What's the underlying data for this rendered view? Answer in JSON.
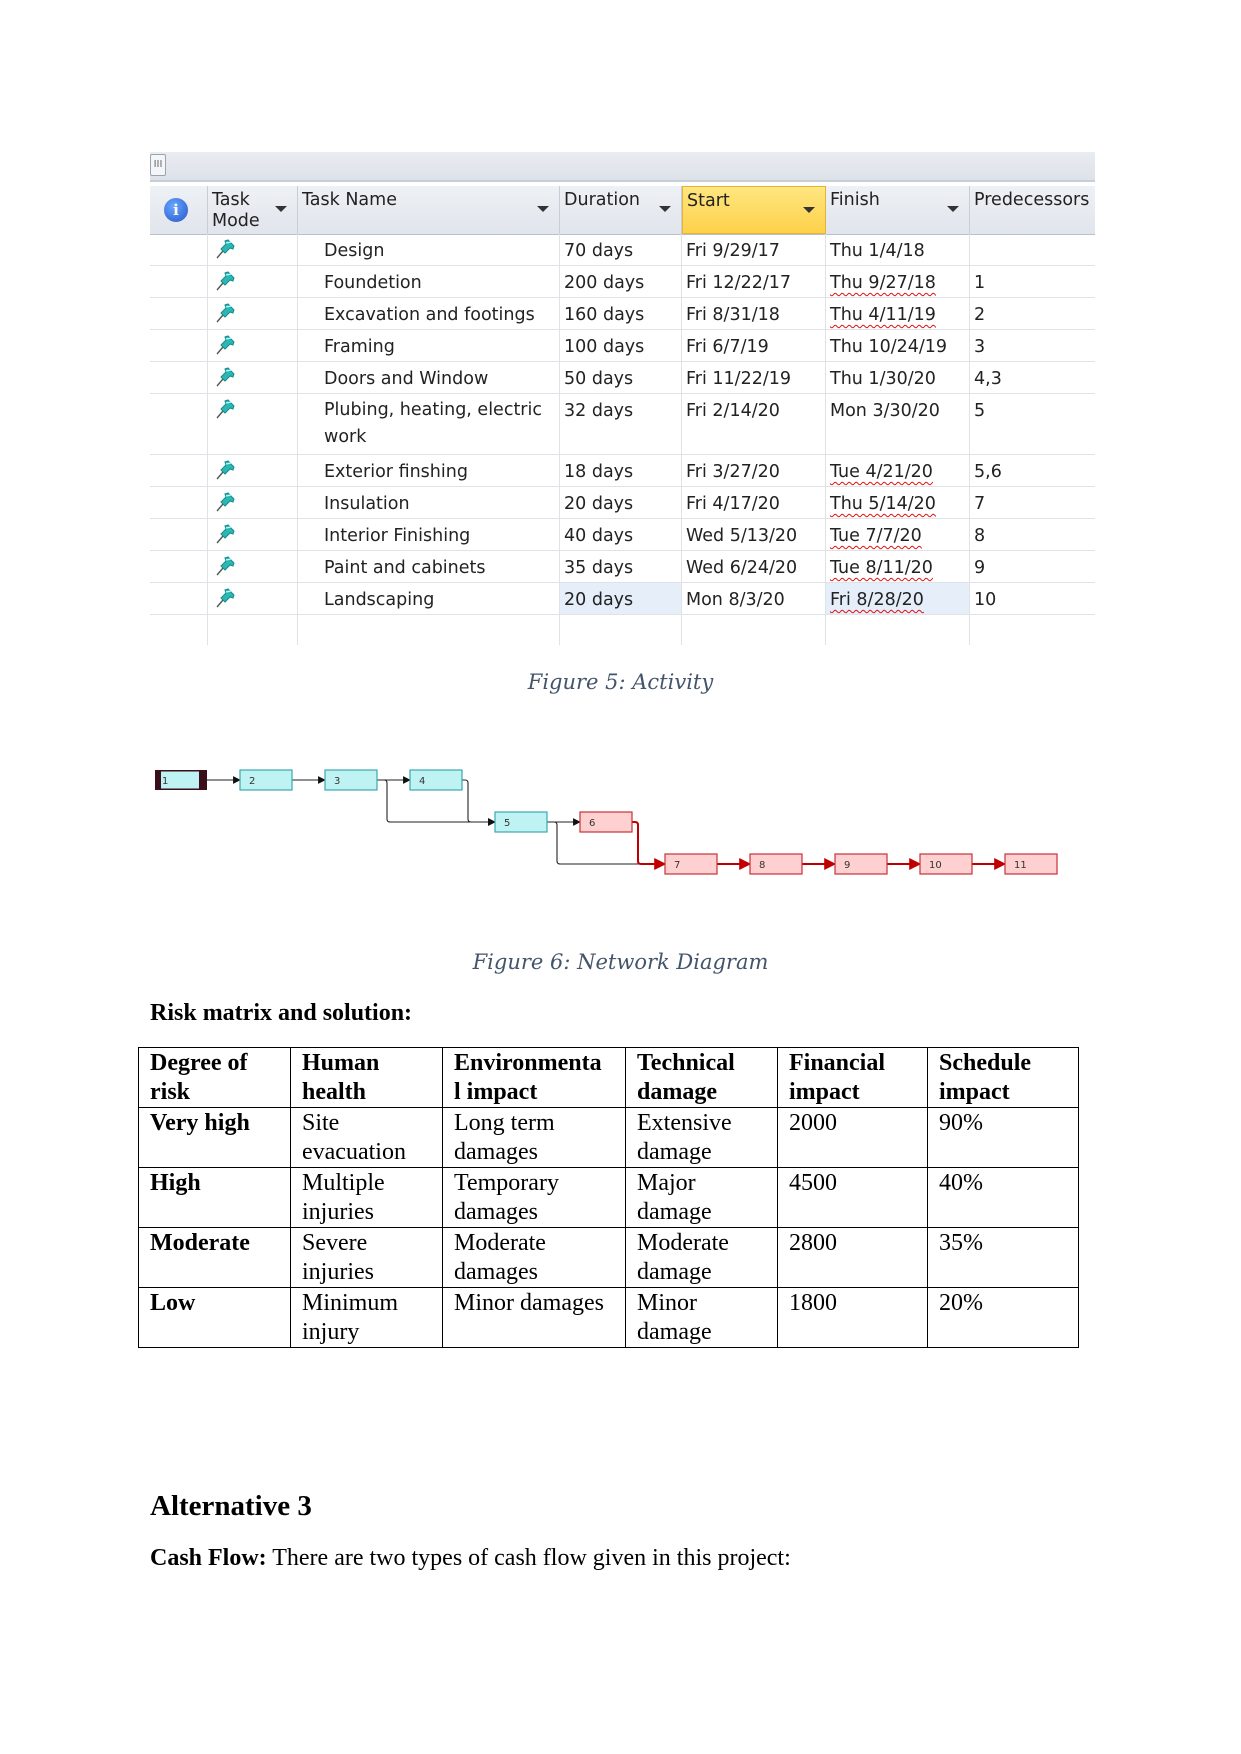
{
  "project_screenshot": {
    "columns": [
      {
        "key": "info",
        "label": ""
      },
      {
        "key": "mode",
        "label": "Task Mode"
      },
      {
        "key": "name",
        "label": "Task Name"
      },
      {
        "key": "duration",
        "label": "Duration"
      },
      {
        "key": "start",
        "label": "Start"
      },
      {
        "key": "finish",
        "label": "Finish"
      },
      {
        "key": "pred",
        "label": "Predecessors"
      }
    ],
    "info_icon_glyph": "i",
    "scroll_thumb_glyph": "III",
    "tasks": [
      {
        "name": "Design",
        "duration": "70 days",
        "start": "Fri 9/29/17",
        "finish": "Thu 1/4/18",
        "predecessors": "",
        "finish_flagged": false
      },
      {
        "name": "Foundetion",
        "duration": "200 days",
        "start": "Fri 12/22/17",
        "finish": "Thu 9/27/18",
        "predecessors": "1",
        "finish_flagged": true
      },
      {
        "name": "Excavation and footings",
        "duration": "160 days",
        "start": "Fri 8/31/18",
        "finish": "Thu 4/11/19",
        "predecessors": "2",
        "finish_flagged": true
      },
      {
        "name": "Framing",
        "duration": "100 days",
        "start": "Fri 6/7/19",
        "finish": "Thu 10/24/19",
        "predecessors": "3",
        "finish_flagged": false
      },
      {
        "name": "Doors and Window",
        "duration": "50 days",
        "start": "Fri 11/22/19",
        "finish": "Thu 1/30/20",
        "predecessors": "4,3",
        "finish_flagged": false
      },
      {
        "name": "Plubing, heating, electric work",
        "duration": "32 days",
        "start": "Fri 2/14/20",
        "finish": "Mon 3/30/20",
        "predecessors": "5",
        "finish_flagged": false
      },
      {
        "name": "Exterior finshing",
        "duration": "18 days",
        "start": "Fri 3/27/20",
        "finish": "Tue 4/21/20",
        "predecessors": "5,6",
        "finish_flagged": true
      },
      {
        "name": "Insulation",
        "duration": "20 days",
        "start": "Fri 4/17/20",
        "finish": "Thu 5/14/20",
        "predecessors": "7",
        "finish_flagged": true
      },
      {
        "name": "Interior Finishing",
        "duration": "40 days",
        "start": "Wed 5/13/20",
        "finish": "Tue 7/7/20",
        "predecessors": "8",
        "finish_flagged": true
      },
      {
        "name": "Paint and cabinets",
        "duration": "35 days",
        "start": "Wed 6/24/20",
        "finish": "Tue 8/11/20",
        "predecessors": "9",
        "finish_flagged": true
      },
      {
        "name": "Landscaping",
        "duration": "20 days",
        "start": "Mon 8/3/20",
        "finish": "Fri 8/28/20",
        "predecessors": "10",
        "finish_flagged": true
      }
    ],
    "highlight_color": "#fdd14a",
    "pin_color": "#2bb7b3"
  },
  "figure5_caption": "Figure 5: Activity",
  "network": {
    "nodes": [
      {
        "id": "1",
        "critical": false,
        "start": true
      },
      {
        "id": "2",
        "critical": false
      },
      {
        "id": "3",
        "critical": false
      },
      {
        "id": "4",
        "critical": false
      },
      {
        "id": "5",
        "critical": false
      },
      {
        "id": "6",
        "critical": true
      },
      {
        "id": "7",
        "critical": true
      },
      {
        "id": "8",
        "critical": true
      },
      {
        "id": "9",
        "critical": true
      },
      {
        "id": "10",
        "critical": true
      },
      {
        "id": "11",
        "critical": true
      }
    ],
    "edges": [
      {
        "from": "1",
        "to": "2",
        "critical": false
      },
      {
        "from": "2",
        "to": "3",
        "critical": false
      },
      {
        "from": "3",
        "to": "4",
        "critical": false
      },
      {
        "from": "3",
        "to": "5",
        "critical": false
      },
      {
        "from": "4",
        "to": "5",
        "critical": false
      },
      {
        "from": "5",
        "to": "6",
        "critical": false
      },
      {
        "from": "5",
        "to": "7",
        "critical": false
      },
      {
        "from": "6",
        "to": "7",
        "critical": true
      },
      {
        "from": "7",
        "to": "8",
        "critical": true
      },
      {
        "from": "8",
        "to": "9",
        "critical": true
      },
      {
        "from": "9",
        "to": "10",
        "critical": true
      },
      {
        "from": "10",
        "to": "11",
        "critical": true
      }
    ],
    "colors": {
      "normal_fill": "#bff3f3",
      "normal_stroke": "#3aa9b0",
      "critical_fill": "#ffd0d0",
      "critical_stroke": "#c8303a",
      "critical_line": "#c00000",
      "start_frame": "#3a0f1a"
    }
  },
  "figure6_caption": "Figure 6: Network Diagram",
  "risk_heading": "Risk matrix and solution:",
  "risk_table": {
    "headers": [
      "Degree of risk",
      "Human health",
      "Environmental impact",
      "Technical damage",
      "Financial impact",
      "Schedule impact"
    ],
    "header_display": [
      "Degree of\nrisk",
      "Human\nhealth",
      "Environmenta\nl impact",
      "Technical\ndamage",
      "Financial\nimpact",
      "Schedule\nimpact"
    ],
    "rows": [
      {
        "level": "Very high",
        "human": "Site evacuation",
        "env": "Long term damages",
        "tech": "Extensive damage",
        "fin": "2000",
        "sched": "90%"
      },
      {
        "level": "High",
        "human": "Multiple injuries",
        "env": "Temporary damages",
        "tech": "Major damage",
        "fin": "4500",
        "sched": "40%"
      },
      {
        "level": "Moderate",
        "human": "Severe injuries",
        "env": "Moderate damages",
        "tech": "Moderate damage",
        "fin": "2800",
        "sched": "35%"
      },
      {
        "level": "Low",
        "human": "Minimum injury",
        "env": "Minor damages",
        "tech": "Minor damage",
        "fin": "1800",
        "sched": "20%"
      }
    ]
  },
  "alternative_heading": "Alternative 3",
  "cash_flow": {
    "label": "Cash Flow:",
    "text": " There are two types of cash flow given in this project:"
  }
}
